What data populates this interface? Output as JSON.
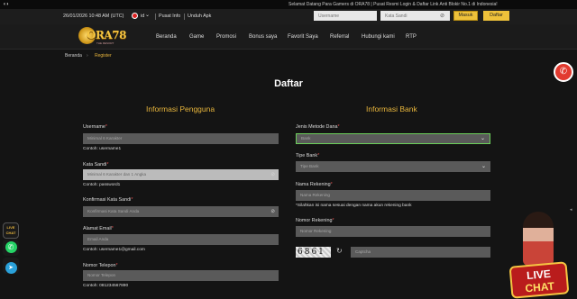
{
  "ticker": {
    "text": "Selamat Datang Para Gamers di ORA78 | Pusat Resmi Login & Daftar Link Anti Blokir No.1 di Indonesia!"
  },
  "topbar": {
    "datetime": "26/01/2026 10:48 AM (UTC)",
    "language": "id",
    "pusat_info": "Pusat Info",
    "unduh_apk": "Unduh Apk",
    "username_placeholder": "Username",
    "password_placeholder": "Kata Sandi",
    "masuk": "Masuk",
    "daftar": "Daftar"
  },
  "logo": {
    "text": "ORA78",
    "sub": "THE RESORT"
  },
  "nav": [
    "Beranda",
    "Game",
    "Promosi",
    "Bonus saya",
    "Favorit Saya",
    "Referral",
    "Hubungi kami",
    "RTP"
  ],
  "breadcrumb": {
    "home": "Beranda",
    "current": "Register"
  },
  "page_title": "Daftar",
  "left": {
    "title": "Informasi Pengguna",
    "username_label": "Username",
    "username_placeholder": "Minimal 6 Karakter",
    "username_hint": "Contoh: username1",
    "password_label": "Kata Sandi",
    "password_placeholder": "Minimal 6 Karakter dan 1 Angka",
    "password_hint": "Contoh: password1",
    "confirm_label": "Konfirmasi Kata Sandi",
    "confirm_placeholder": "Konfirmasi Kata Sandi Anda",
    "email_label": "Alamat Email",
    "email_placeholder": "Email Anda",
    "email_hint": "Contoh: username1@gmail.com",
    "phone_label": "Nomor Telepon",
    "phone_placeholder": "Nomor Telepon",
    "phone_hint": "Contoh: 081234567890"
  },
  "right": {
    "title": "Informasi Bank",
    "method_label": "Jenis Metode Dana",
    "method_value": "Bank",
    "type_label": "Tipe Bank",
    "type_value": "Tipe Bank",
    "account_name_label": "Nama Rekening",
    "account_name_placeholder": "Nama Rekening",
    "account_name_hint": "*Silahkan isi nama sesuai dengan nama akun rekening bank",
    "account_number_label": "Nomor Rekening",
    "account_number_placeholder": "Nomor Rekening",
    "captcha_value": "6861",
    "captcha_placeholder": "Captcha"
  },
  "side": {
    "livechat": "LIVE CHAT"
  },
  "promo": {
    "live": "LIVE",
    "chat": "CHAT"
  },
  "colors": {
    "accent": "#e7b53c",
    "bg": "#141414",
    "field": "#5a5a5a",
    "phone": "#e23a2f"
  }
}
